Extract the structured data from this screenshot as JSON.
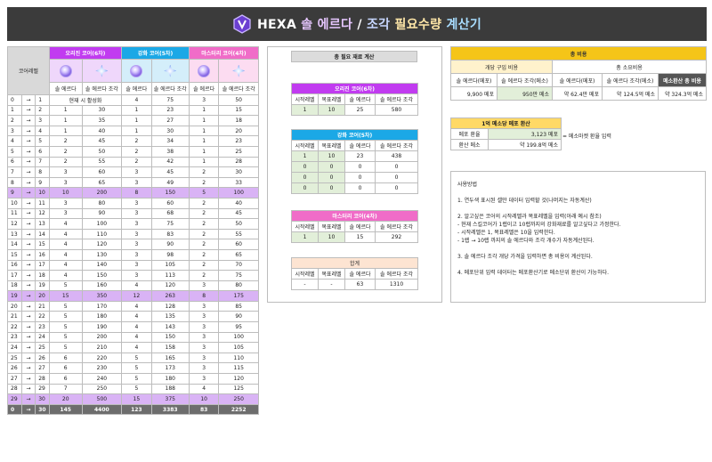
{
  "header": {
    "title_prefix": "HEXA",
    "title_a": "솔 에르다",
    "title_sep": " / ",
    "title_b": "조각",
    "title_c": "필요수량",
    "title_d": "계산기"
  },
  "left_table": {
    "level_header": "코어레벨",
    "groups": [
      "오리진 코어(6차)",
      "강화 코어(5차)",
      "마스터리 코어(4차)"
    ],
    "sub_headers": [
      "솔 에르다",
      "솔 에르다 조각"
    ],
    "arrow": "→",
    "rows": [
      {
        "from": "0",
        "to": "1",
        "o_erda": "현재 시 활성화",
        "o_piece": "",
        "e_erda": "4",
        "e_piece": "75",
        "m_erda": "3",
        "m_piece": "50"
      },
      {
        "from": "1",
        "to": "2",
        "o_erda": "1",
        "o_piece": "30",
        "e_erda": "1",
        "e_piece": "23",
        "m_erda": "1",
        "m_piece": "15"
      },
      {
        "from": "2",
        "to": "3",
        "o_erda": "1",
        "o_piece": "35",
        "e_erda": "1",
        "e_piece": "27",
        "m_erda": "1",
        "m_piece": "18"
      },
      {
        "from": "3",
        "to": "4",
        "o_erda": "1",
        "o_piece": "40",
        "e_erda": "1",
        "e_piece": "30",
        "m_erda": "1",
        "m_piece": "20"
      },
      {
        "from": "4",
        "to": "5",
        "o_erda": "2",
        "o_piece": "45",
        "e_erda": "2",
        "e_piece": "34",
        "m_erda": "1",
        "m_piece": "23"
      },
      {
        "from": "5",
        "to": "6",
        "o_erda": "2",
        "o_piece": "50",
        "e_erda": "2",
        "e_piece": "38",
        "m_erda": "1",
        "m_piece": "25"
      },
      {
        "from": "6",
        "to": "7",
        "o_erda": "2",
        "o_piece": "55",
        "e_erda": "2",
        "e_piece": "42",
        "m_erda": "1",
        "m_piece": "28"
      },
      {
        "from": "7",
        "to": "8",
        "o_erda": "3",
        "o_piece": "60",
        "e_erda": "3",
        "e_piece": "45",
        "m_erda": "2",
        "m_piece": "30"
      },
      {
        "from": "8",
        "to": "9",
        "o_erda": "3",
        "o_piece": "65",
        "e_erda": "3",
        "e_piece": "49",
        "m_erda": "2",
        "m_piece": "33"
      },
      {
        "from": "9",
        "to": "10",
        "o_erda": "10",
        "o_piece": "200",
        "e_erda": "8",
        "e_piece": "150",
        "m_erda": "5",
        "m_piece": "100",
        "hl": true
      },
      {
        "from": "10",
        "to": "11",
        "o_erda": "3",
        "o_piece": "80",
        "e_erda": "3",
        "e_piece": "60",
        "m_erda": "2",
        "m_piece": "40"
      },
      {
        "from": "11",
        "to": "12",
        "o_erda": "3",
        "o_piece": "90",
        "e_erda": "3",
        "e_piece": "68",
        "m_erda": "2",
        "m_piece": "45"
      },
      {
        "from": "12",
        "to": "13",
        "o_erda": "4",
        "o_piece": "100",
        "e_erda": "3",
        "e_piece": "75",
        "m_erda": "2",
        "m_piece": "50"
      },
      {
        "from": "13",
        "to": "14",
        "o_erda": "4",
        "o_piece": "110",
        "e_erda": "3",
        "e_piece": "83",
        "m_erda": "2",
        "m_piece": "55"
      },
      {
        "from": "14",
        "to": "15",
        "o_erda": "4",
        "o_piece": "120",
        "e_erda": "3",
        "e_piece": "90",
        "m_erda": "2",
        "m_piece": "60"
      },
      {
        "from": "15",
        "to": "16",
        "o_erda": "4",
        "o_piece": "130",
        "e_erda": "3",
        "e_piece": "98",
        "m_erda": "2",
        "m_piece": "65"
      },
      {
        "from": "16",
        "to": "17",
        "o_erda": "4",
        "o_piece": "140",
        "e_erda": "3",
        "e_piece": "105",
        "m_erda": "2",
        "m_piece": "70"
      },
      {
        "from": "17",
        "to": "18",
        "o_erda": "4",
        "o_piece": "150",
        "e_erda": "3",
        "e_piece": "113",
        "m_erda": "2",
        "m_piece": "75"
      },
      {
        "from": "18",
        "to": "19",
        "o_erda": "5",
        "o_piece": "160",
        "e_erda": "4",
        "e_piece": "120",
        "m_erda": "3",
        "m_piece": "80"
      },
      {
        "from": "19",
        "to": "20",
        "o_erda": "15",
        "o_piece": "350",
        "e_erda": "12",
        "e_piece": "263",
        "m_erda": "8",
        "m_piece": "175",
        "hl": true
      },
      {
        "from": "20",
        "to": "21",
        "o_erda": "5",
        "o_piece": "170",
        "e_erda": "4",
        "e_piece": "128",
        "m_erda": "3",
        "m_piece": "85"
      },
      {
        "from": "21",
        "to": "22",
        "o_erda": "5",
        "o_piece": "180",
        "e_erda": "4",
        "e_piece": "135",
        "m_erda": "3",
        "m_piece": "90"
      },
      {
        "from": "22",
        "to": "23",
        "o_erda": "5",
        "o_piece": "190",
        "e_erda": "4",
        "e_piece": "143",
        "m_erda": "3",
        "m_piece": "95"
      },
      {
        "from": "23",
        "to": "24",
        "o_erda": "5",
        "o_piece": "200",
        "e_erda": "4",
        "e_piece": "150",
        "m_erda": "3",
        "m_piece": "100"
      },
      {
        "from": "24",
        "to": "25",
        "o_erda": "5",
        "o_piece": "210",
        "e_erda": "4",
        "e_piece": "158",
        "m_erda": "3",
        "m_piece": "105"
      },
      {
        "from": "25",
        "to": "26",
        "o_erda": "6",
        "o_piece": "220",
        "e_erda": "5",
        "e_piece": "165",
        "m_erda": "3",
        "m_piece": "110"
      },
      {
        "from": "26",
        "to": "27",
        "o_erda": "6",
        "o_piece": "230",
        "e_erda": "5",
        "e_piece": "173",
        "m_erda": "3",
        "m_piece": "115"
      },
      {
        "from": "27",
        "to": "28",
        "o_erda": "6",
        "o_piece": "240",
        "e_erda": "5",
        "e_piece": "180",
        "m_erda": "3",
        "m_piece": "120"
      },
      {
        "from": "28",
        "to": "29",
        "o_erda": "7",
        "o_piece": "250",
        "e_erda": "5",
        "e_piece": "188",
        "m_erda": "4",
        "m_piece": "125"
      },
      {
        "from": "29",
        "to": "30",
        "o_erda": "20",
        "o_piece": "500",
        "e_erda": "15",
        "e_piece": "375",
        "m_erda": "10",
        "m_piece": "250",
        "hl": true
      }
    ],
    "total": {
      "from": "0",
      "to": "30",
      "o_erda": "145",
      "o_piece": "4400",
      "e_erda": "123",
      "e_piece": "3383",
      "m_erda": "83",
      "m_piece": "2252"
    }
  },
  "middle": {
    "title": "총 필요 재료 계산",
    "col_headers": [
      "시작레벨",
      "목표레벨",
      "솔 에르다",
      "솔 에르다 조각"
    ],
    "origin": {
      "title": "오리진 코어(6차)",
      "rows": [
        [
          "1",
          "10",
          "25",
          "580"
        ]
      ]
    },
    "enhance": {
      "title": "강화 코어(5차)",
      "rows": [
        [
          "1",
          "10",
          "23",
          "438"
        ],
        [
          "0",
          "0",
          "0",
          "0"
        ],
        [
          "0",
          "0",
          "0",
          "0"
        ],
        [
          "0",
          "0",
          "0",
          "0"
        ]
      ]
    },
    "mastery": {
      "title": "마스터리 코어(4차)",
      "rows": [
        [
          "1",
          "10",
          "15",
          "292"
        ]
      ]
    },
    "sum": {
      "title": "합계",
      "rows": [
        [
          "-",
          "-",
          "63",
          "1310"
        ]
      ]
    }
  },
  "cost": {
    "title": "총 비용",
    "left_group": "개당 구입 비용",
    "right_group": "총 소요비용",
    "headers": [
      "솔 에르다(메포)",
      "솔 에르다 조각(메소)",
      "솔 에르다(메포)",
      "솔 에르다 조각(메소)",
      "메소환산 총 비용"
    ],
    "values": [
      "9,900 메포",
      "950만 메소",
      "약 62.4만 메포",
      "약 124.5억 메소",
      "약 324.3억 메소"
    ]
  },
  "exchange": {
    "title": "1억 메소당 메포 환산",
    "rate_label": "메포 환율",
    "rate_value": "3,123 메포",
    "meso_label": "환산 메소",
    "meso_value": "약 199.8억 메소",
    "note": "= 메소마켓 환율 입력"
  },
  "usage": {
    "lines": [
      "사용방법",
      "",
      "1. 연두색 표시된 셀만 데이터 입력할 것(나머지는 자동계산)",
      "",
      "2. 알고싶은 코어의 시작레벨과 목표레벨을 입력(아래 예시 참조)",
      " - 현재 스킬코어가 1렙이고 10렙까지의 강화재료를 알고싶다고 가정한다.",
      " - 시작레벨은 1, 목표레벨은 10을 입력한다.",
      " - 1렙 → 10렙 까지의 솔 에르다와 조각 개수가 자동계산된다.",
      "",
      "3. 솔 에르다 조각 개당 가격을 입력하면 총 비용이 계산된다.",
      "",
      "4. 메포단위 입력 데이터는 메포환산기로 메소단위 환산이 가능하다."
    ]
  }
}
